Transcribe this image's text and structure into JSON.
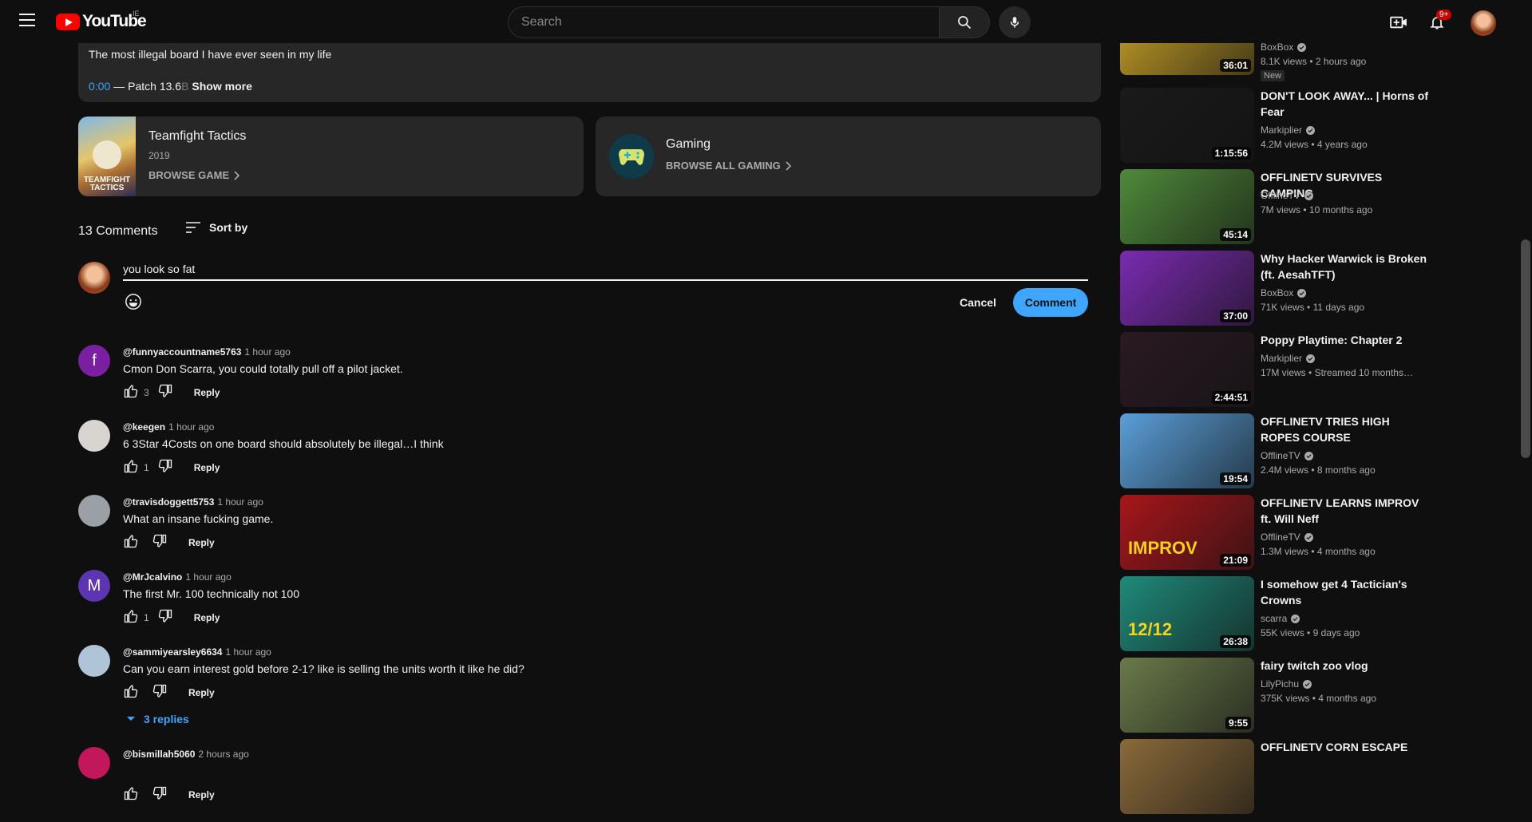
{
  "header": {
    "logo_text": "YouTube",
    "country_code": "IE",
    "search_placeholder": "Search",
    "notifications_badge": "9+"
  },
  "description": {
    "text": "The most illegal board I have ever seen in my life",
    "timestamp": "0:00",
    "chapter": "— Patch 13.6",
    "fade": "B",
    "show_more": "Show more"
  },
  "game_card": {
    "thumb_label": "TEAMFIGHT TACTICS",
    "title": "Teamfight Tactics",
    "year": "2019",
    "link": "BROWSE GAME"
  },
  "category_card": {
    "title": "Gaming",
    "link": "BROWSE ALL GAMING"
  },
  "comments": {
    "count": "13 Comments",
    "sort_label": "Sort by",
    "draft": "you look so fat",
    "cancel": "Cancel",
    "submit": "Comment",
    "reply_label": "Reply",
    "replies_toggle": "3 replies",
    "items": [
      {
        "author": "@funnyaccountname5763",
        "time": "1 hour ago",
        "text": "Cmon Don Scarra, you could totally pull off a pilot jacket.",
        "likes": "3",
        "avatar_letter": "f",
        "avatar_color": "#7b1fa2"
      },
      {
        "author": "@keegen",
        "time": "1 hour ago",
        "text": "6 3Star 4Costs on one board should absolutely be illegal…I think",
        "likes": "1",
        "avatar_letter": "",
        "avatar_color": "#d8d4cf"
      },
      {
        "author": "@travisdoggett5753",
        "time": "1 hour ago",
        "text": "What an insane fucking game.",
        "likes": "",
        "avatar_letter": "",
        "avatar_color": "#9aa0a6"
      },
      {
        "author": "@MrJcalvino",
        "time": "1 hour ago",
        "text": "The first  Mr. 100 technically not 100",
        "likes": "1",
        "avatar_letter": "M",
        "avatar_color": "#5e35b1"
      },
      {
        "author": "@sammiyearsley6634",
        "time": "1 hour ago",
        "text": "Can you earn interest gold before 2-1? like is selling the units worth it like he did?",
        "likes": "",
        "avatar_letter": "",
        "avatar_color": "#b0c4d8"
      },
      {
        "author": "@bismillah5060",
        "time": "2 hours ago",
        "text": "",
        "likes": "",
        "avatar_letter": "",
        "avatar_color": "#c2185b"
      }
    ]
  },
  "recommendations": [
    {
      "title": "",
      "channel": "BoxBox",
      "views": "8.1K views",
      "age": "2 hours ago",
      "duration": "36:01",
      "badge": "New",
      "thumb": "#c9a227"
    },
    {
      "title": "DON'T LOOK AWAY... | Horns of Fear",
      "channel": "Markiplier",
      "views": "4.2M views",
      "age": "4 years ago",
      "duration": "1:15:56",
      "thumb": "#1a1a1a"
    },
    {
      "title": "OFFLINETV SURVIVES CAMPING",
      "channel": "OfflineTV",
      "views": "7M views",
      "age": "10 months ago",
      "duration": "45:14",
      "thumb": "#4f8a3a"
    },
    {
      "title": "Why Hacker Warwick is Broken (ft. AesahTFT)",
      "channel": "BoxBox",
      "views": "71K views",
      "age": "11 days ago",
      "duration": "37:00",
      "thumb": "#7a2bb0"
    },
    {
      "title": "Poppy Playtime: Chapter 2",
      "channel": "Markiplier",
      "views": "17M views",
      "age": "Streamed 10 months…",
      "duration": "2:44:51",
      "thumb": "#2a1a22"
    },
    {
      "title": "OFFLINETV TRIES HIGH ROPES COURSE",
      "channel": "OfflineTV",
      "views": "2.4M views",
      "age": "8 months ago",
      "duration": "19:54",
      "thumb": "#5a9fd8"
    },
    {
      "title": "OFFLINETV LEARNS IMPROV ft. Will Neff",
      "channel": "OfflineTV",
      "views": "1.3M views",
      "age": "4 months ago",
      "duration": "21:09",
      "thumb": "#a8161b",
      "thumb_text": "IMPROV"
    },
    {
      "title": "I somehow get 4 Tactician's Crowns",
      "channel": "scarra",
      "views": "55K views",
      "age": "9 days ago",
      "duration": "26:38",
      "thumb": "#1f8a7a",
      "thumb_text": "12/12"
    },
    {
      "title": "fairy twitch zoo vlog",
      "channel": "LilyPichu",
      "views": "375K views",
      "age": "4 months ago",
      "duration": "9:55",
      "thumb": "#6a7a4a"
    },
    {
      "title": "OFFLINETV CORN ESCAPE",
      "channel": "",
      "views": "",
      "age": "",
      "duration": "",
      "thumb": "#8a6a3a"
    }
  ]
}
